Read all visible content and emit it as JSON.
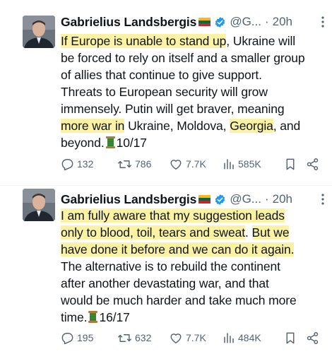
{
  "tweets": [
    {
      "author_name": "Gabrielius Landsbergis",
      "flag": "lithuania-flag-emoji",
      "handle": "@G...",
      "separator": "·",
      "time": "20h",
      "text_lines": [
        [
          {
            "t": "If Europe is unable to stand up",
            "hl": true
          },
          {
            "t": ", Ukraine will"
          }
        ],
        [
          {
            "t": "be forced to rely on itself and a smaller group"
          }
        ],
        [
          {
            "t": "of allies that continue to give support."
          }
        ],
        [
          {
            "t": "Threats to European security will grow"
          }
        ],
        [
          {
            "t": "immensely. Putin will get braver, meaning"
          }
        ],
        [
          {
            "t": "more war in",
            "hl": true
          },
          {
            "t": " Ukraine, Moldova, "
          },
          {
            "t": "Georgia",
            "hl": true
          },
          {
            "t": ", and"
          }
        ],
        [
          {
            "t": "beyond."
          },
          {
            "spool": true
          },
          {
            "t": "10/17"
          }
        ]
      ],
      "replies": "132",
      "reposts": "786",
      "likes": "7.7K",
      "views": "585K"
    },
    {
      "author_name": "Gabrielius Landsbergis",
      "flag": "lithuania-flag-emoji",
      "handle": "@G...",
      "separator": "·",
      "time": "20h",
      "text_lines": [
        [
          {
            "t": "I am fully aware that my suggestion leads",
            "hl": true
          }
        ],
        [
          {
            "t": "only to blood, toil, tears and sweat",
            "hl": true
          },
          {
            "t": ". "
          },
          {
            "t": "But we",
            "hl": true
          }
        ],
        [
          {
            "t": "have done it before and we can do it again.",
            "hl": true
          }
        ],
        [
          {
            "t": "The alternative is to rebuild the continent"
          }
        ],
        [
          {
            "t": "after another devastating war, and that"
          }
        ],
        [
          {
            "t": "would be much harder and take much more"
          }
        ],
        [
          {
            "t": "time."
          },
          {
            "spool": true
          },
          {
            "t": "16/17"
          }
        ]
      ],
      "replies": "195",
      "reposts": "632",
      "likes": "7.7K",
      "views": "484K"
    }
  ],
  "icons": {
    "verified": "verified-badge-icon",
    "more": "more-options-icon",
    "reply": "reply-icon",
    "repost": "repost-icon",
    "like": "like-icon",
    "views": "views-icon",
    "bookmark": "bookmark-icon",
    "share": "share-icon",
    "thread_marker": "spool-of-thread-emoji"
  },
  "colors": {
    "highlight": "#fbf3a3",
    "verified_blue": "#1d9bf0",
    "secondary_text": "#536471",
    "primary_text": "#0f1419"
  }
}
